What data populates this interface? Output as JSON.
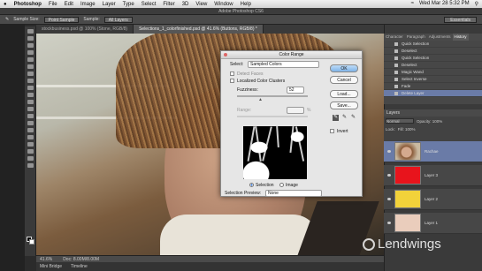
{
  "menubar": {
    "apple": "",
    "items": [
      "Photoshop",
      "File",
      "Edit",
      "Image",
      "Layer",
      "Type",
      "Select",
      "Filter",
      "3D",
      "View",
      "Window",
      "Help"
    ],
    "clock": "Wed Mar 28  5:32 PM"
  },
  "app": {
    "title": "Adobe Photoshop CS6"
  },
  "options": {
    "sample_size_label": "Sample Size:",
    "sample_size": "Point Sample",
    "sample_label": "Sample:",
    "sample": "All Layers",
    "workspace": "Essentials"
  },
  "document_tabs": [
    {
      "label": "stockbusiness.psd @ 100% (Stone, RGB/8)",
      "active": false
    },
    {
      "label": "Selections_1_colorfinished.psd @ 41.6% (Buttons, RGB/8) *",
      "active": true
    }
  ],
  "status": {
    "zoom": "41.6%",
    "doc": "Doc: 8.00M/8.00M"
  },
  "bottom_tabs": [
    "Mini Bridge",
    "Timeline"
  ],
  "watermark": "Lendwings",
  "panels": {
    "tabs": [
      "Character",
      "Paragraph",
      "Adjustments",
      "History"
    ],
    "history": [
      "Quick Selection",
      "Deselect",
      "Quick Selection",
      "Deselect",
      "Magic Wand",
      "Select Inverse",
      "Fade",
      "Delete Layer"
    ],
    "history_selected": 7,
    "layers_title": "Layers",
    "blend": "Normal",
    "opacity_label": "Opacity: 100%",
    "fill_label": "Fill: 100%",
    "lock_label": "Lock:",
    "layers": [
      {
        "name": "Rachae",
        "color": "#c79a7e",
        "selected": true
      },
      {
        "name": "Layer 3",
        "color": "#e8141c",
        "selected": false
      },
      {
        "name": "Layer 2",
        "color": "#f2d23a",
        "selected": false
      },
      {
        "name": "Layer 1",
        "color": "#eacdbc",
        "selected": false
      }
    ]
  },
  "dialog": {
    "title": "Color Range",
    "select_label": "Select:",
    "select_value": "Sampled Colors",
    "detect_faces": "Detect Faces",
    "localized": "Localized Color Clusters",
    "fuzziness_label": "Fuzziness:",
    "fuzziness": "52",
    "range_label": "Range:",
    "range_unit": "%",
    "ok": "OK",
    "cancel": "Cancel",
    "load": "Load...",
    "save": "Save...",
    "invert": "Invert",
    "radio_selection": "Selection",
    "radio_image": "Image",
    "preview_label": "Selection Preview:",
    "preview_value": "None"
  }
}
